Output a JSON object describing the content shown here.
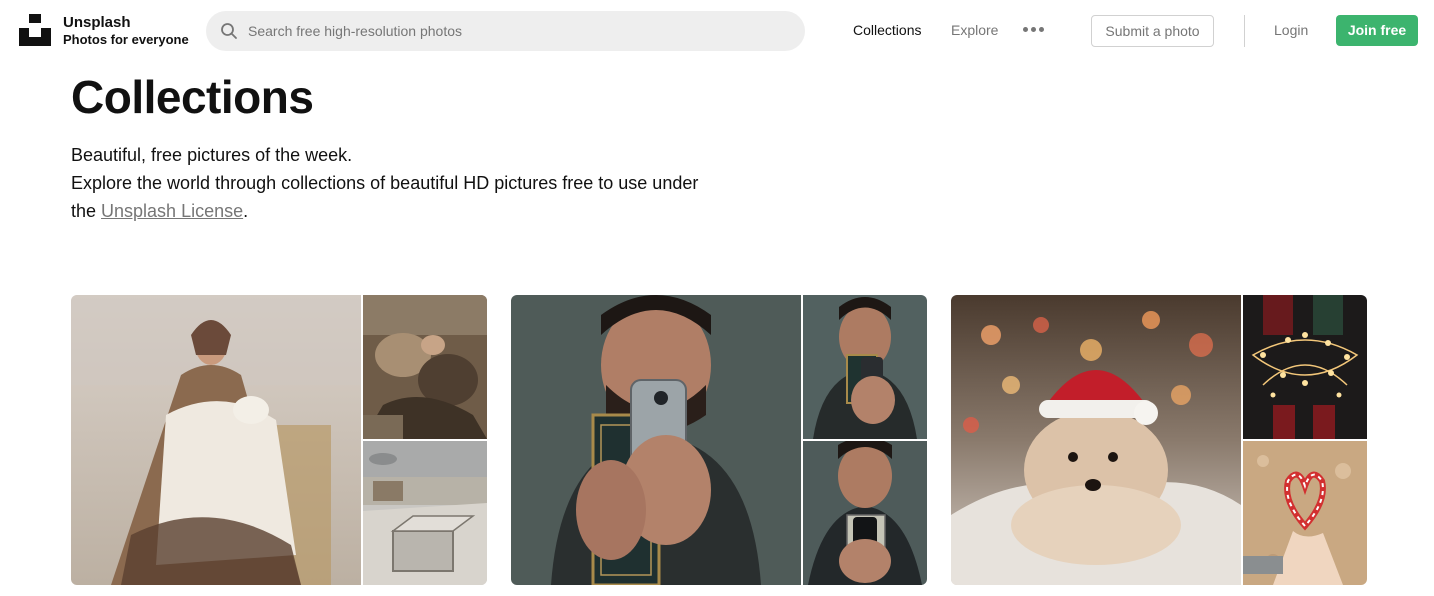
{
  "header": {
    "brand_name": "Unsplash",
    "brand_tagline": "Photos for everyone",
    "search_placeholder": "Search free high-resolution photos",
    "nav": {
      "collections": "Collections",
      "explore": "Explore"
    },
    "submit_label": "Submit a photo",
    "login_label": "Login",
    "join_label": "Join free"
  },
  "main": {
    "title": "Collections",
    "intro_line1": "Beautiful, free pictures of the week.",
    "intro_line2": "Explore the world through collections of beautiful HD pictures free to use under",
    "intro_prefix": "the ",
    "license_link": "Unsplash License",
    "intro_suffix": "."
  },
  "colors": {
    "accent_green": "#3cb46e",
    "muted_text": "#767676",
    "search_bg": "#eeeeee"
  },
  "collections": [
    {
      "images": [
        "vintage-painting-woman-with-child",
        "painting-fragment-figures",
        "painting-stone-ruins-landscape"
      ]
    },
    {
      "images": [
        "man-holding-phone-and-book",
        "man-looking-down-at-phone",
        "man-holding-phone"
      ]
    },
    {
      "images": [
        "puppy-with-santa-hat",
        "christmas-fairy-lights",
        "candy-cane-heart-in-hand"
      ]
    }
  ]
}
